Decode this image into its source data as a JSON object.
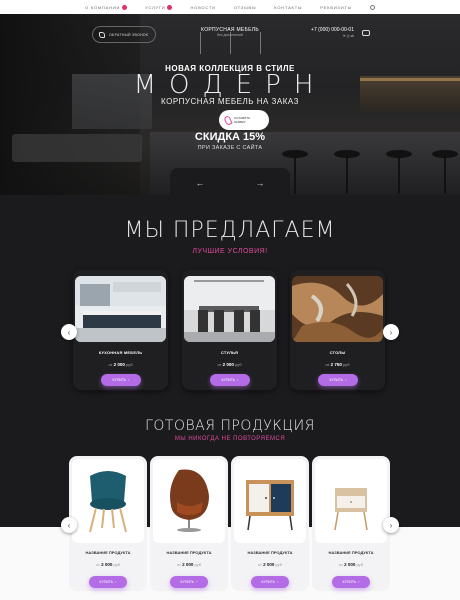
{
  "nav": {
    "items": [
      "О КОМПАНИИ",
      "УСЛУГИ",
      "НОВОСТИ",
      "ОТЗЫВЫ",
      "КОНТАКТЫ",
      "РЕКВИЗИТЫ"
    ]
  },
  "header": {
    "call_label": "ОБРАТНЫЙ ЗВОНОК",
    "logo_line1": "КОРПУСНАЯ МЕБЕЛЬ",
    "logo_line2": "без дополнений",
    "phone": "+7 (000) 000-00-01",
    "socials": "✈ ◎ vk"
  },
  "hero": {
    "subtitle": "НОВАЯ КОЛЛЕКЦИЯ В СТИЛЕ",
    "title": "МОДЕРН",
    "tagline": "КОРПУСНАЯ МЕБЕЛЬ НА ЗАКАЗ",
    "cta_line1": "ОСТАВИТЬ",
    "cta_line2": "ЗАЯВКУ",
    "discount": "СКИДКА 15%",
    "discount_note": "ПРИ ЗАКАЗЕ С САЙТА",
    "prev": "←",
    "next": "→"
  },
  "offer": {
    "title": "МЫ ПРЕДЛАГАЕМ",
    "subtitle": "ЛУЧШИЕ УСЛОВИЯ!",
    "cards": [
      {
        "name": "КУХОННАЯ МЕБЕЛЬ",
        "price_from": "от",
        "price": "2 000",
        "currency": "руб"
      },
      {
        "name": "СТУЛЬЯ",
        "price_from": "от",
        "price": "2 000",
        "currency": "руб"
      },
      {
        "name": "СТОЛЫ",
        "price_from": "от",
        "price": "2 750",
        "currency": "руб"
      }
    ],
    "buy_label": "КУПИТЬ",
    "prev": "‹",
    "next": "›"
  },
  "products": {
    "title": "ГОТОВАЯ ПРОДУКЦИЯ",
    "subtitle": "МЫ НИКОГДА НЕ ПОВТОРЯЕМСЯ",
    "cards": [
      {
        "name": "НАЗВАНИЕ ПРОДУКТА",
        "price_from": "от",
        "price": "2 000",
        "currency": "руб"
      },
      {
        "name": "НАЗВАНИЕ ПРОДУКТА",
        "price_from": "от",
        "price": "2 000",
        "currency": "руб"
      },
      {
        "name": "НАЗВАНИЕ ПРОДУКТА",
        "price_from": "от",
        "price": "2 000",
        "currency": "руб"
      },
      {
        "name": "НАЗВАНИЕ ПРОДУКТА",
        "price_from": "от",
        "price": "2 000",
        "currency": "руб"
      }
    ],
    "buy_label": "КУПИТЬ",
    "prev": "‹",
    "next": "›"
  },
  "colors": {
    "accent": "#b46ce6",
    "pink": "#e14a9c",
    "background": "#1b1b1d"
  }
}
